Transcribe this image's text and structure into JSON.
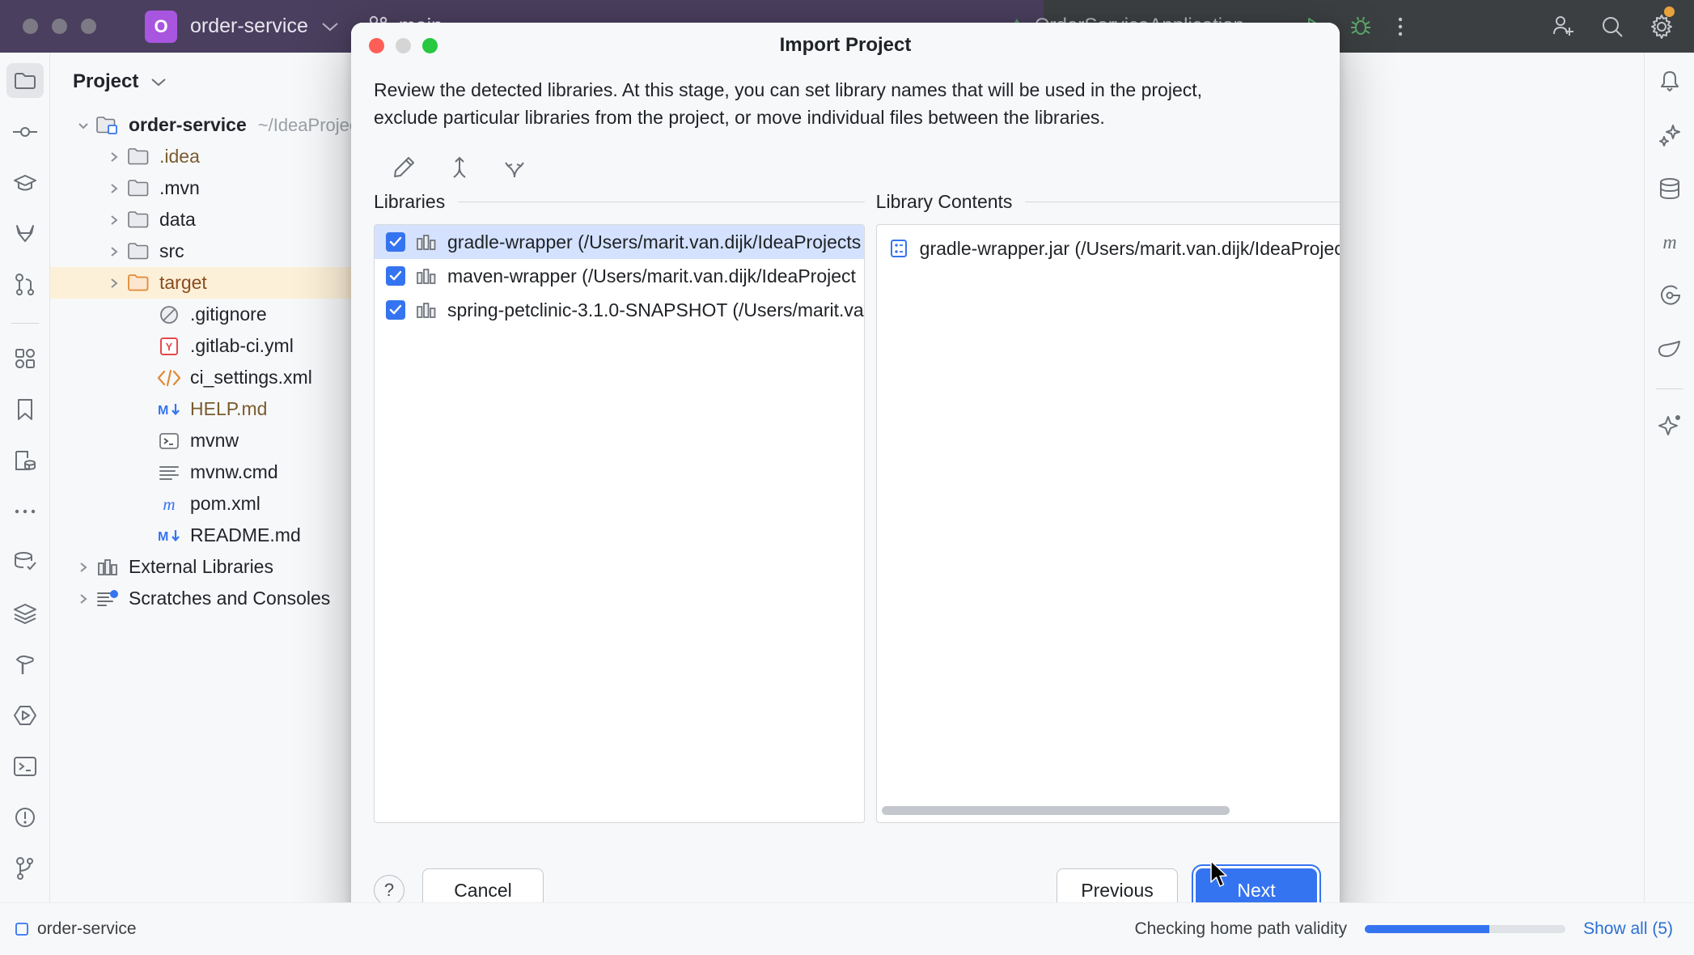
{
  "titlebar": {
    "project_badge": "O",
    "project_name": "order-service",
    "branch_name": "main",
    "run_config": "OrderServiceApplication",
    "icons": {
      "run": "run-icon",
      "debug": "debug-icon",
      "more": "more-options-icon",
      "invite": "add-user-icon",
      "search": "search-icon",
      "settings": "settings-icon"
    }
  },
  "left_stripe": {
    "items": [
      {
        "name": "project-tool-window",
        "icon": "folder-icon",
        "selected": true
      },
      {
        "name": "commit-tool-window",
        "icon": "commit-icon",
        "selected": false
      },
      {
        "name": "learn-tool-window",
        "icon": "graduation-cap-icon",
        "selected": false
      },
      {
        "name": "gitlab-tool-window",
        "icon": "gitlab-icon",
        "selected": false
      },
      {
        "name": "pull-requests-tool-window",
        "icon": "pull-request-icon",
        "selected": false
      },
      {
        "name": "structure-tool-window",
        "icon": "structure-icon",
        "selected": false
      },
      {
        "name": "bookmarks-tool-window",
        "icon": "bookmark-icon",
        "selected": false
      },
      {
        "name": "database-file-tool-window",
        "icon": "file-database-icon",
        "selected": false
      },
      {
        "name": "more-tool-windows",
        "icon": "ellipsis-icon",
        "selected": false
      },
      {
        "name": "database-tool-window",
        "icon": "database-check-icon",
        "selected": false
      },
      {
        "name": "layers-tool-window",
        "icon": "layers-icon",
        "selected": false
      },
      {
        "name": "build-tool-window",
        "icon": "hammer-icon",
        "selected": false
      },
      {
        "name": "run-tool-window",
        "icon": "run-hex-icon",
        "selected": false
      },
      {
        "name": "terminal-tool-window",
        "icon": "terminal-icon",
        "selected": false
      },
      {
        "name": "problems-tool-window",
        "icon": "warning-icon",
        "selected": false
      },
      {
        "name": "version-control-tool-window",
        "icon": "branch-icon",
        "selected": false
      }
    ]
  },
  "right_stripe": {
    "items": [
      {
        "name": "notifications-tool-window",
        "icon": "bell-icon"
      },
      {
        "name": "ai-sparkle-tool-window",
        "icon": "sparkles-icon"
      },
      {
        "name": "database-tool-window",
        "icon": "database-icon"
      },
      {
        "name": "maven-tool-window",
        "icon": "maven-m-icon"
      },
      {
        "name": "gradle-tool-window",
        "icon": "gradle-icon"
      },
      {
        "name": "spring-tool-window",
        "icon": "spring-leaf-icon"
      },
      {
        "name": "ai-assistant-tool-window",
        "icon": "ai-assistant-icon"
      }
    ]
  },
  "project_panel": {
    "title": "Project",
    "tree": [
      {
        "label": "order-service",
        "path": "~/IdeaProject",
        "depth": 0,
        "arrow": "down",
        "icon": "module-folder-icon",
        "bold": true,
        "highlight": false,
        "color": "default"
      },
      {
        "label": ".idea",
        "path": "",
        "depth": 1,
        "arrow": "right",
        "icon": "folder-icon",
        "bold": false,
        "highlight": false,
        "color": "brown"
      },
      {
        "label": ".mvn",
        "path": "",
        "depth": 1,
        "arrow": "right",
        "icon": "folder-icon",
        "bold": false,
        "highlight": false,
        "color": "default"
      },
      {
        "label": "data",
        "path": "",
        "depth": 1,
        "arrow": "right",
        "icon": "folder-icon",
        "bold": false,
        "highlight": false,
        "color": "default"
      },
      {
        "label": "src",
        "path": "",
        "depth": 1,
        "arrow": "right",
        "icon": "folder-icon",
        "bold": false,
        "highlight": false,
        "color": "default"
      },
      {
        "label": "target",
        "path": "",
        "depth": 1,
        "arrow": "right",
        "icon": "folder-orange-icon",
        "bold": false,
        "highlight": true,
        "color": "orange"
      },
      {
        "label": ".gitignore",
        "path": "",
        "depth": 2,
        "arrow": "none",
        "icon": "gitignore-icon",
        "bold": false,
        "highlight": false,
        "color": "default"
      },
      {
        "label": ".gitlab-ci.yml",
        "path": "",
        "depth": 2,
        "arrow": "none",
        "icon": "yaml-icon",
        "bold": false,
        "highlight": false,
        "color": "default"
      },
      {
        "label": "ci_settings.xml",
        "path": "",
        "depth": 2,
        "arrow": "none",
        "icon": "xml-icon",
        "bold": false,
        "highlight": false,
        "color": "default"
      },
      {
        "label": "HELP.md",
        "path": "",
        "depth": 2,
        "arrow": "none",
        "icon": "markdown-icon",
        "bold": false,
        "highlight": false,
        "color": "brown"
      },
      {
        "label": "mvnw",
        "path": "",
        "depth": 2,
        "arrow": "none",
        "icon": "shell-script-icon",
        "bold": false,
        "highlight": false,
        "color": "default"
      },
      {
        "label": "mvnw.cmd",
        "path": "",
        "depth": 2,
        "arrow": "none",
        "icon": "text-file-icon",
        "bold": false,
        "highlight": false,
        "color": "default"
      },
      {
        "label": "pom.xml",
        "path": "",
        "depth": 2,
        "arrow": "none",
        "icon": "maven-pom-icon",
        "bold": false,
        "highlight": false,
        "color": "default"
      },
      {
        "label": "README.md",
        "path": "",
        "depth": 2,
        "arrow": "none",
        "icon": "markdown-icon",
        "bold": false,
        "highlight": false,
        "color": "default"
      },
      {
        "label": "External Libraries",
        "path": "",
        "depth": 0,
        "arrow": "right",
        "icon": "library-icon",
        "bold": false,
        "highlight": false,
        "color": "default"
      },
      {
        "label": "Scratches and Consoles",
        "path": "",
        "depth": 0,
        "arrow": "right",
        "icon": "scratches-icon",
        "bold": false,
        "highlight": false,
        "color": "default"
      }
    ]
  },
  "dialog": {
    "title": "Import Project",
    "description": "Review the detected libraries. At this stage, you can set library names that will be used in the project, exclude particular libraries from the project, or move individual files between the libraries.",
    "toolbar": [
      {
        "name": "rename-library-button",
        "icon": "pencil-icon"
      },
      {
        "name": "merge-libraries-button",
        "icon": "merge-up-icon"
      },
      {
        "name": "split-library-button",
        "icon": "split-arrows-icon"
      }
    ],
    "libraries_pane": {
      "title": "Libraries",
      "items": [
        {
          "checked": true,
          "label": "gradle-wrapper (/Users/marit.van.dijk/IdeaProjects",
          "selected": true
        },
        {
          "checked": true,
          "label": "maven-wrapper (/Users/marit.van.dijk/IdeaProject",
          "selected": false
        },
        {
          "checked": true,
          "label": "spring-petclinic-3.1.0-SNAPSHOT (/Users/marit.va",
          "selected": false
        }
      ]
    },
    "contents_pane": {
      "title": "Library Contents",
      "items": [
        {
          "label": "gradle-wrapper.jar (/Users/marit.van.dijk/IdeaProjects",
          "icon": "jar-file-icon"
        }
      ]
    },
    "footer": {
      "help_label": "?",
      "cancel_label": "Cancel",
      "previous_label": "Previous",
      "next_label": "Next"
    }
  },
  "statusbar": {
    "project_label": "order-service",
    "task_label": "Checking home path validity",
    "progress_percent": 62,
    "show_all_label": "Show all (5)"
  },
  "colors": {
    "accent_blue": "#3574f0",
    "titlebar_purple": "#4a3f5e",
    "titlebar_dark": "#3c3f41",
    "badge_purple": "#a855e0",
    "highlight_row": "#fdf0d8",
    "selection_blue": "#d4e2ff"
  }
}
